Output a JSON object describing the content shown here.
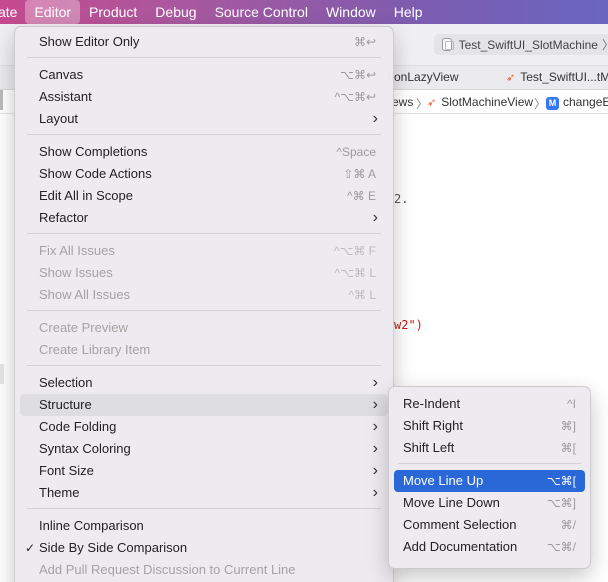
{
  "menubar": {
    "items": [
      "ate",
      "Editor",
      "Product",
      "Debug",
      "Source Control",
      "Window",
      "Help"
    ]
  },
  "toolbar": {
    "scheme": "Test_SwiftUI_SlotMachine",
    "scheme_chevron": "〉"
  },
  "tabs": {
    "tab1": "tionLazyView",
    "tab2": "Test_SwiftUI...tM"
  },
  "jumpbar": {
    "seg1": "ews",
    "sep": "〉",
    "seg2": "SlotMachineView",
    "badge": "M",
    "seg3": "changeE"
  },
  "code": {
    "line1": "2.",
    "line2": "w2\")"
  },
  "editor_menu": {
    "items": [
      {
        "label": "Show Editor Only",
        "shortcut": "⌘↩"
      },
      {
        "label": "Canvas",
        "shortcut": "⌥⌘↩"
      },
      {
        "label": "Assistant",
        "shortcut": "^⌥⌘↩"
      },
      {
        "label": "Layout",
        "shortcut": ""
      },
      {
        "label": "Show Completions",
        "shortcut": "^Space"
      },
      {
        "label": "Show Code Actions",
        "shortcut": "⇧⌘ A"
      },
      {
        "label": "Edit All in Scope",
        "shortcut": "^⌘ E"
      },
      {
        "label": "Refactor",
        "shortcut": ""
      },
      {
        "label": "Fix All Issues",
        "shortcut": "^⌥⌘ F"
      },
      {
        "label": "Show Issues",
        "shortcut": "^⌥⌘ L"
      },
      {
        "label": "Show All Issues",
        "shortcut": "^⌘ L"
      },
      {
        "label": "Create Preview",
        "shortcut": ""
      },
      {
        "label": "Create Library Item",
        "shortcut": ""
      },
      {
        "label": "Selection",
        "shortcut": ""
      },
      {
        "label": "Structure",
        "shortcut": ""
      },
      {
        "label": "Code Folding",
        "shortcut": ""
      },
      {
        "label": "Syntax Coloring",
        "shortcut": ""
      },
      {
        "label": "Font Size",
        "shortcut": ""
      },
      {
        "label": "Theme",
        "shortcut": ""
      },
      {
        "label": "Inline Comparison",
        "shortcut": ""
      },
      {
        "label": "Side By Side Comparison",
        "shortcut": ""
      },
      {
        "label": "Add Pull Request Discussion to Current Line",
        "shortcut": ""
      }
    ],
    "arrow": "›",
    "checkmark": "✓"
  },
  "structure_submenu": {
    "items": [
      {
        "label": "Re-Indent",
        "shortcut": "^I"
      },
      {
        "label": "Shift Right",
        "shortcut": "⌘]"
      },
      {
        "label": "Shift Left",
        "shortcut": "⌘["
      },
      {
        "label": "Move Line Up",
        "shortcut": "⌥⌘["
      },
      {
        "label": "Move Line Down",
        "shortcut": "⌥⌘]"
      },
      {
        "label": "Comment Selection",
        "shortcut": "⌘/"
      },
      {
        "label": "Add Documentation",
        "shortcut": "⌥⌘/"
      }
    ]
  },
  "colors": {
    "selection": "#2a68d8",
    "swift_orange": "#ef5a2b",
    "string_red": "#c41a16"
  }
}
